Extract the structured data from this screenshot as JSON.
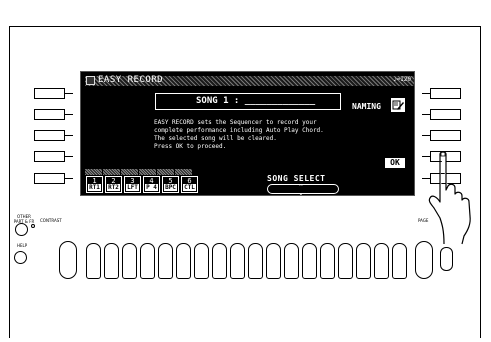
{
  "screen": {
    "title": "EASY RECORD",
    "tempo": "♩=120",
    "song_line": "SONG 1 : _____________",
    "naming_label": "NAMING",
    "message_lines": [
      "EASY RECORD sets the Sequencer to record your",
      "complete performance including Auto Play Chord.",
      "The selected song will be cleared.",
      "Press OK to proceed."
    ],
    "ok_label": "OK",
    "song_select_label": "SONG SELECT",
    "part_buttons": [
      {
        "num": "1",
        "label": "RT1"
      },
      {
        "num": "2",
        "label": "RT2"
      },
      {
        "num": "3",
        "label": "LFT"
      },
      {
        "num": "4",
        "label": "P 4"
      },
      {
        "num": "5",
        "label": "BPC"
      },
      {
        "num": "6",
        "label": "CTL"
      }
    ]
  },
  "panel": {
    "other_part_label": "OTHER\nPART & FR",
    "contrast_label": "CONTRAST",
    "help_label": "HELP",
    "page_label": "PAGE"
  },
  "icons": {
    "pencil": "pencil-icon",
    "hand": "pointing-hand-icon",
    "chevron": "up-down-chevron-icon"
  }
}
